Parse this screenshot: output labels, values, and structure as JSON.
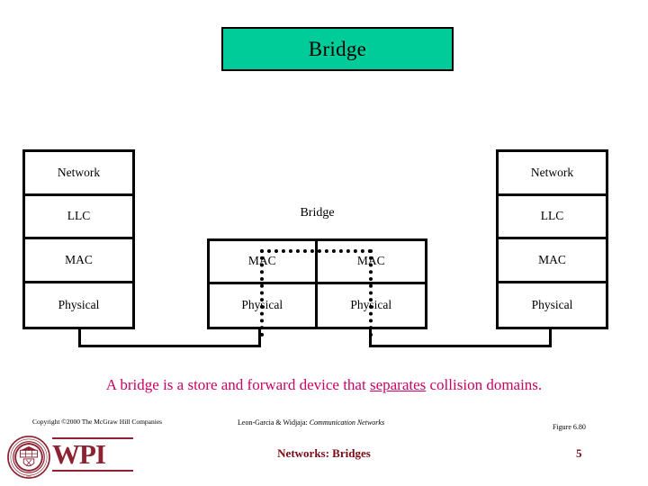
{
  "slide": {
    "title": "Bridge",
    "title_box_color": "#00CC99",
    "caption_color": "#CC0066",
    "footer_color": "#7B0A16",
    "logo_color": "#8C2232"
  },
  "left_stack": {
    "name": "end-system-protocol-stack-left",
    "layers": [
      {
        "label": "Network"
      },
      {
        "label": "LLC"
      },
      {
        "label": "MAC"
      },
      {
        "label": "Physical"
      }
    ]
  },
  "right_stack": {
    "name": "end-system-protocol-stack-right",
    "layers": [
      {
        "label": "Network"
      },
      {
        "label": "LLC"
      },
      {
        "label": "MAC"
      },
      {
        "label": "Physical"
      }
    ]
  },
  "bridge": {
    "label": "Bridge",
    "cells": [
      {
        "label": "MAC"
      },
      {
        "label": "MAC"
      },
      {
        "label": "Physical"
      },
      {
        "label": "Physical"
      }
    ]
  },
  "caption": {
    "before": "A bridge is a store and forward device that ",
    "emphasis": "separates",
    "after": " collision domains."
  },
  "credits": {
    "copyright": "Copyright ©2000 The McGraw Hill Companies",
    "book_authors": "Leon-Garcia & Widjaja:",
    "book_title": "Communication Networks",
    "figure": "Figure 6.80"
  },
  "logo": {
    "wordmark": "WPI",
    "seal_text_top": "WORCESTER POLYTECHNIC",
    "seal_text_bottom": "INSTITUTE",
    "seal_year": "1865"
  },
  "footer": {
    "title": "Networks: Bridges",
    "page": "5"
  },
  "chart_data": {
    "type": "diagram",
    "title": "Bridge",
    "nodes": [
      {
        "id": "left-stack",
        "layers": [
          "Network",
          "LLC",
          "MAC",
          "Physical"
        ]
      },
      {
        "id": "bridge",
        "label": "Bridge",
        "layers": [
          "MAC",
          "Physical"
        ],
        "ports": 2
      },
      {
        "id": "right-stack",
        "layers": [
          "Network",
          "LLC",
          "MAC",
          "Physical"
        ]
      }
    ],
    "edges": [
      {
        "from": "left-stack.Physical",
        "to": "bridge.port1.Physical",
        "style": "solid"
      },
      {
        "from": "bridge.port2.Physical",
        "to": "right-stack.Physical",
        "style": "solid"
      },
      {
        "from": "bridge.port1.Physical",
        "to": "bridge.port1.MAC",
        "style": "dotted"
      },
      {
        "from": "bridge.port1.MAC",
        "to": "bridge.port2.MAC",
        "style": "dotted"
      },
      {
        "from": "bridge.port2.MAC",
        "to": "bridge.port2.Physical",
        "style": "dotted"
      }
    ]
  }
}
